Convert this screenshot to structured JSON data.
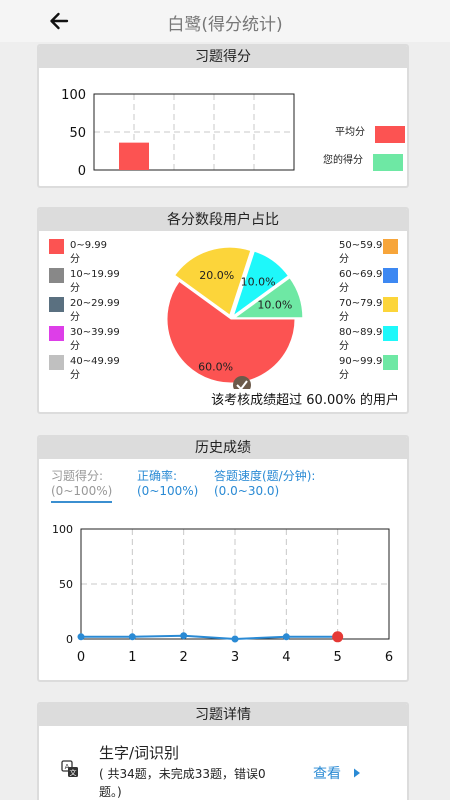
{
  "header": {
    "title": "白鹭(得分统计)"
  },
  "score_card": {
    "title": "习题得分",
    "legend": [
      {
        "label": "平均分",
        "color": "#fc5352"
      },
      {
        "label": "您的得分",
        "color": "#6ee8a4"
      }
    ]
  },
  "distribution_card": {
    "title": "各分数段用户占比",
    "legend_left": [
      {
        "label": "0~9.99分",
        "color": "#fc5352"
      },
      {
        "label": "10~19.99分",
        "color": "#888888"
      },
      {
        "label": "20~29.99分",
        "color": "#5a7080"
      },
      {
        "label": "30~39.99分",
        "color": "#dd3ee8"
      },
      {
        "label": "40~49.99分",
        "color": "#c0c0c0"
      }
    ],
    "legend_right": [
      {
        "label": "50~59.99分",
        "color": "#f7a53a"
      },
      {
        "label": "60~69.99分",
        "color": "#3d88f2"
      },
      {
        "label": "70~79.99分",
        "color": "#fcd53a"
      },
      {
        "label": "80~89.99分",
        "color": "#1ef8fa"
      },
      {
        "label": "90~99.99分",
        "color": "#6ee8a4"
      }
    ],
    "caption": "该考核成绩超过 60.00% 的用户"
  },
  "history_card": {
    "title": "历史成绩",
    "tabs": [
      {
        "label": "习题得分:",
        "range": "(0~100%)"
      },
      {
        "label": "正确率:",
        "range": "(0~100%)"
      },
      {
        "label": "答题速度(题/分钟):",
        "range": "(0.0~30.0)"
      }
    ],
    "line_color": "#2a8ad4",
    "last_point_color": "#e53935"
  },
  "exercise_card": {
    "title": "习题详情",
    "items": [
      {
        "name": "生字/词识别",
        "desc": "( 共34题，未完成33题，错误0题。)",
        "action": "查看"
      }
    ]
  },
  "chart_data": [
    {
      "type": "bar",
      "title": "习题得分",
      "categories": [
        ""
      ],
      "series": [
        {
          "name": "平均分",
          "values": [
            36
          ],
          "color": "#fc5352"
        },
        {
          "name": "您的得分",
          "values": [
            0
          ],
          "color": "#6ee8a4"
        }
      ],
      "ylim": [
        0,
        100
      ],
      "yticks": [
        0,
        50,
        100
      ],
      "grid": true,
      "legend": "right"
    },
    {
      "type": "pie",
      "title": "各分数段用户占比",
      "slices": [
        {
          "name": "0~9.99分",
          "value": 60,
          "label": "60.0%",
          "color": "#fc5352"
        },
        {
          "name": "70~79.99分",
          "value": 20,
          "label": "20.0%",
          "color": "#fcd53a"
        },
        {
          "name": "80~89.99分",
          "value": 10,
          "label": "10.0%",
          "color": "#1ef8fa"
        },
        {
          "name": "90~99.99分",
          "value": 10,
          "label": "10.0%",
          "color": "#6ee8a4"
        }
      ]
    },
    {
      "type": "line",
      "title": "历史成绩",
      "x": [
        0,
        1,
        2,
        3,
        4,
        5
      ],
      "values": [
        2,
        2,
        3,
        0,
        2,
        2
      ],
      "xticks": [
        0,
        1,
        2,
        3,
        4,
        5,
        6
      ],
      "yticks": [
        0,
        50,
        100
      ],
      "xlim": [
        0,
        6
      ],
      "ylim": [
        0,
        100
      ],
      "grid": true
    }
  ]
}
